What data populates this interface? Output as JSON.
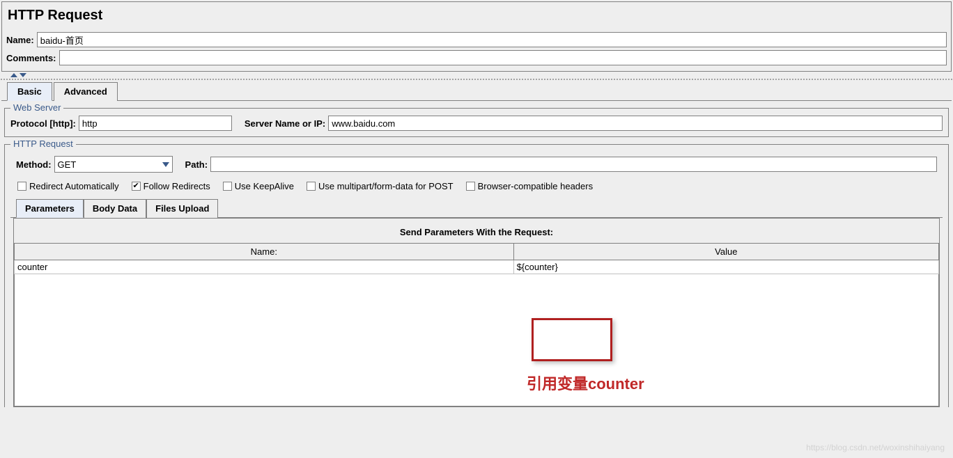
{
  "title": "HTTP Request",
  "name_label": "Name:",
  "name_value": "baidu-首页",
  "comments_label": "Comments:",
  "comments_value": "",
  "main_tabs": {
    "basic": "Basic",
    "advanced": "Advanced"
  },
  "web_server": {
    "legend": "Web Server",
    "protocol_label": "Protocol [http]:",
    "protocol_value": "http",
    "server_label": "Server Name or IP:",
    "server_value": "www.baidu.com"
  },
  "http_request": {
    "legend": "HTTP Request",
    "method_label": "Method:",
    "method_value": "GET",
    "path_label": "Path:",
    "path_value": "",
    "checks": {
      "redirect_auto": {
        "label": "Redirect Automatically",
        "checked": false
      },
      "follow_redirects": {
        "label": "Follow Redirects",
        "checked": true
      },
      "keepalive": {
        "label": "Use KeepAlive",
        "checked": false
      },
      "multipart": {
        "label": "Use multipart/form-data for POST",
        "checked": false
      },
      "browser_compat": {
        "label": "Browser-compatible headers",
        "checked": false
      }
    }
  },
  "sub_tabs": {
    "parameters": "Parameters",
    "body_data": "Body Data",
    "files_upload": "Files Upload"
  },
  "params": {
    "title": "Send Parameters With the Request:",
    "col_name": "Name:",
    "col_value": "Value",
    "rows": [
      {
        "name": "counter",
        "value": "${counter}"
      }
    ]
  },
  "annotation": "引用变量counter",
  "watermark": "https://blog.csdn.net/woxinshihaiyang"
}
